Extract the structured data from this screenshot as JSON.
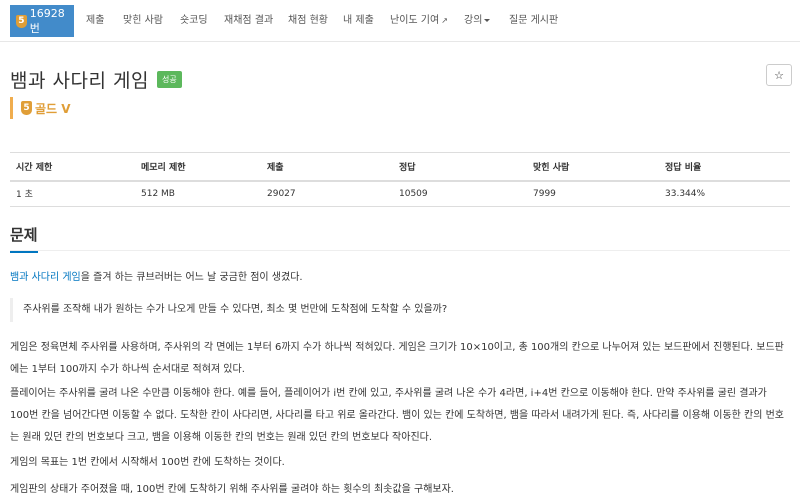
{
  "nav": {
    "problem_number": "16928번",
    "tier_badge": "5",
    "items": [
      "제출",
      "맞힌 사람",
      "숏코딩",
      "재채점 결과",
      "채점 현황",
      "내 제출",
      "난이도 기여",
      "강의",
      "질문 게시판"
    ]
  },
  "problem": {
    "title": "뱀과 사다리 게임",
    "status": "성공",
    "tier_number": "5",
    "tier_label": "골드 V"
  },
  "star_icon": "☆",
  "info_table": {
    "headers": [
      "시간 제한",
      "메모리 제한",
      "제출",
      "정답",
      "맞힌 사람",
      "정답 비율"
    ],
    "values": [
      "1 초",
      "512 MB",
      "29027",
      "10509",
      "7999",
      "33.344%"
    ]
  },
  "section": {
    "title": "문제"
  },
  "content": {
    "intro_link": "뱀과 사다리 게임",
    "intro_rest": "을 즐겨 하는 큐브러버는 어느 날 궁금한 점이 생겼다.",
    "quote": "주사위를 조작해 내가 원하는 수가 나오게 만들 수 있다면, 최소 몇 번만에 도착점에 도착할 수 있을까?",
    "para1": "게임은 정육면체 주사위를 사용하며, 주사위의 각 면에는 1부터 6까지 수가 하나씩 적혀있다. 게임은 크기가 10×10이고, 총 100개의 칸으로 나누어져 있는 보드판에서 진행된다. 보드판에는 1부터 100까지 수가 하나씩 순서대로 적혀져 있다.",
    "para2": "플레이어는 주사위를 굴려 나온 수만큼 이동해야 한다. 예를 들어, 플레이어가 i번 칸에 있고, 주사위를 굴려 나온 수가 4라면, i+4번 칸으로 이동해야 한다. 만약 주사위를 굴린 결과가 100번 칸을 넘어간다면 이동할 수 없다. 도착한 칸이 사다리면, 사다리를 타고 위로 올라간다. 뱀이 있는 칸에 도착하면, 뱀을 따라서 내려가게 된다. 즉, 사다리를 이용해 이동한 칸의 번호는 원래 있던 칸의 번호보다 크고, 뱀을 이용해 이동한 칸의 번호는 원래 있던 칸의 번호보다 작아진다.",
    "para3": "게임의 목표는 1번 칸에서 시작해서 100번 칸에 도착하는 것이다.",
    "para4": "게임판의 상태가 주어졌을 때, 100번 칸에 도착하기 위해 주사위를 굴려야 하는 횟수의 최솟값을 구해보자."
  }
}
